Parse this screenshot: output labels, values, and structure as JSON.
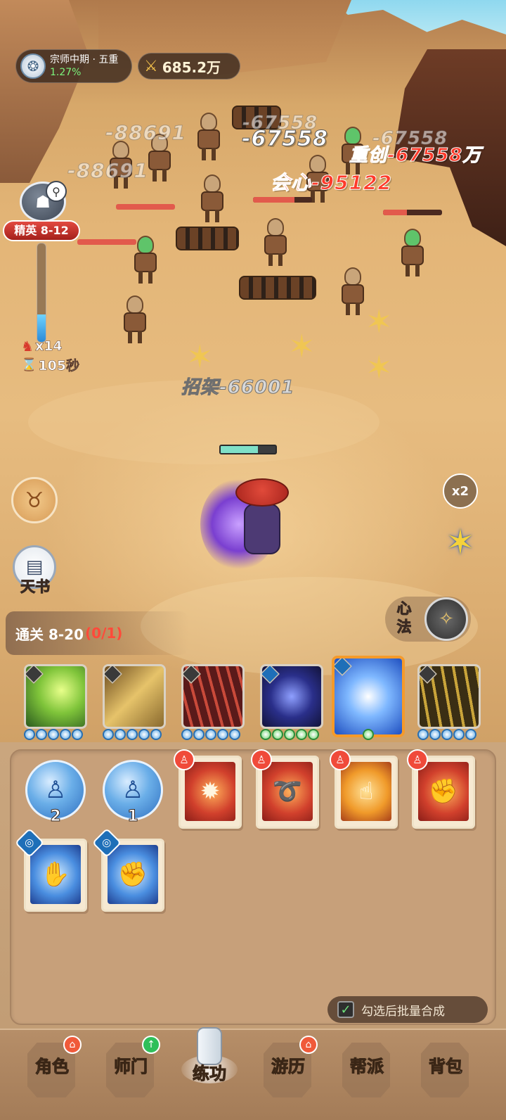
{
  "hud": {
    "rank_title": "宗师中期 · 五重",
    "rank_progress": "1.27%",
    "rank_icon": "master-badge-icon",
    "combat_power": "685.2万",
    "combat_power_icon": "crossed-swords-icon"
  },
  "stage": {
    "elite_label": "精英 8-12",
    "kill_count": "x14",
    "timer": "105秒",
    "progress_fraction": 0.28
  },
  "damage_numbers": [
    "-88691",
    "-88691",
    "-67558",
    "-67558",
    "-67558",
    "重创-67558万",
    "会心-95122",
    "招架-66001"
  ],
  "side_buttons": {
    "tianshu_label": "天书",
    "speed_label": "x2",
    "xinfa_label": "心法"
  },
  "clear_banner": {
    "text": "通关 8-20",
    "progress": "(0/1)"
  },
  "equipped_skills": [
    {
      "name": "wind-blade-skill",
      "gems": 5,
      "gem_color": "blue"
    },
    {
      "name": "earth-slash-skill",
      "gems": 5,
      "gem_color": "blue"
    },
    {
      "name": "blade-rain-skill",
      "gems": 5,
      "gem_color": "blue"
    },
    {
      "name": "shadow-swirl-skill",
      "gems": 5,
      "gem_color": "green"
    },
    {
      "name": "lightning-palm-skill",
      "gems": 1,
      "gem_color": "green",
      "selected": true
    },
    {
      "name": "golden-sword-skill",
      "gems": 5,
      "gem_color": "blue"
    }
  ],
  "inventory": {
    "orbs": [
      {
        "count": "2"
      },
      {
        "count": "1"
      }
    ],
    "cards_row1": [
      {
        "name": "fire-orb-card"
      },
      {
        "name": "fire-whip-card"
      },
      {
        "name": "flame-finger-card"
      },
      {
        "name": "fire-fist-card"
      }
    ],
    "cards_row2": [
      {
        "name": "ice-claw-card"
      },
      {
        "name": "water-fist-card"
      }
    ],
    "batch_merge_label": "勾选后批量合成",
    "batch_merge_checked": true
  },
  "nav": {
    "role": "角色",
    "school": "师门",
    "practice": "练功",
    "travel": "游历",
    "guild": "帮派",
    "backpack": "背包"
  }
}
